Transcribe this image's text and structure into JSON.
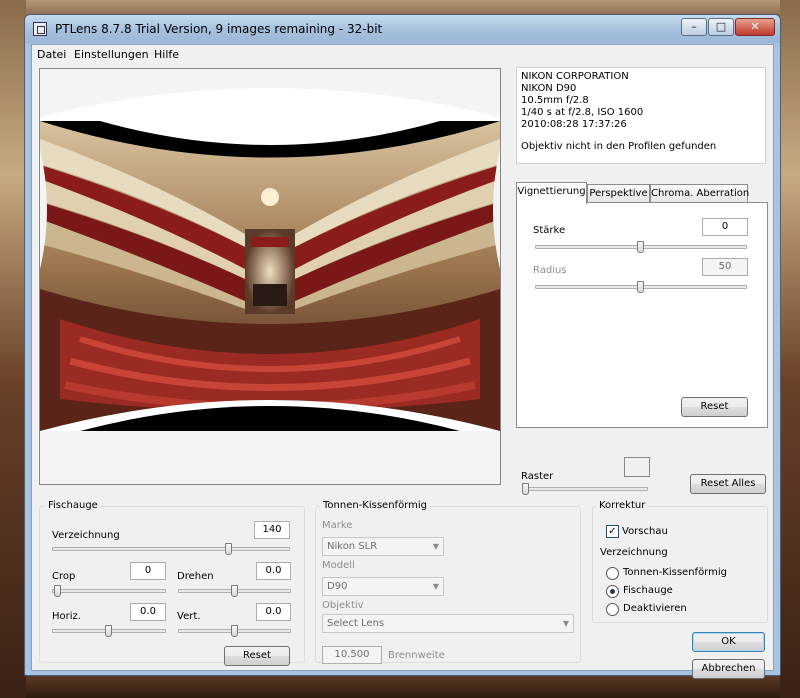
{
  "window": {
    "title": "PTLens 8.7.8 Trial Version, 9 images remaining - 32-bit",
    "minimize": "–",
    "maximize": "□",
    "close": "✕"
  },
  "menu": [
    "Datei",
    "Einstellungen",
    "Hilfe"
  ],
  "info": {
    "lines": [
      "NIKON CORPORATION",
      "NIKON D90",
      "10.5mm f/2.8",
      "1/40 s at f/2.8, ISO 1600",
      "2010:08:28 17:37:26"
    ],
    "message": "Objektiv nicht in den Profilen gefunden"
  },
  "tabs": [
    "Vignettierung",
    "Perspektive",
    "Chroma. Aberration"
  ],
  "vignetting": {
    "strength_label": "Stärke",
    "strength_value": "0",
    "strength_level": 0.5,
    "radius_label": "Radius",
    "radius_value": "50",
    "radius_level": 0.5,
    "reset": "Reset"
  },
  "raster": {
    "label": "Raster",
    "level": 0.0
  },
  "reset_all": "Reset Alles",
  "fisheye": {
    "title": "Fischauge",
    "distortion_label": "Verzeichnung",
    "distortion_value": "140",
    "crop_label": "Crop",
    "crop_value": "0",
    "rotate_label": "Drehen",
    "rotate_value": "0.0",
    "horiz_label": "Horiz.",
    "horiz_value": "0.0",
    "vert_label": "Vert.",
    "vert_value": "0.0",
    "reset": "Reset"
  },
  "barrel": {
    "title": "Tonnen-Kissenförmig",
    "make_label": "Marke",
    "make_value": "Nikon SLR",
    "model_label": "Modell",
    "model_value": "D90",
    "lens_label": "Objektiv",
    "lens_value": "Select Lens",
    "focal_value": "10.500",
    "focal_label": "Brennweite"
  },
  "correction": {
    "title": "Korrektur",
    "preview_label": "Vorschau",
    "preview_checked": true,
    "distortion_label": "Verzeichnung",
    "options": [
      "Tonnen-Kissenförmig",
      "Fischauge",
      "Deaktivieren"
    ],
    "selected": "Fischauge"
  },
  "ok": "OK",
  "cancel": "Abbrechen",
  "colors": {
    "accent": "#3c7fb1",
    "titlebar": "#a9c4df",
    "theater_red": "#8a1c1c"
  },
  "icons": [
    "app-icon",
    "dropdown-arrow-icon",
    "checkmark-icon"
  ]
}
